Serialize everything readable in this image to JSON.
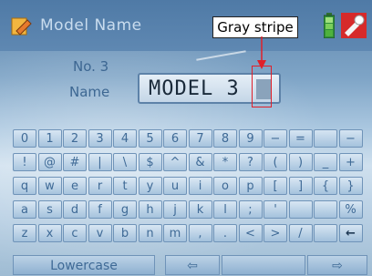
{
  "header": {
    "title": "Model Name"
  },
  "annotation": {
    "label": "Gray stripe"
  },
  "form": {
    "no_label": "No. 3",
    "name_label": "Name",
    "name_value": "MODEL 3"
  },
  "keyboard": {
    "rows": [
      [
        "0",
        "1",
        "2",
        "3",
        "4",
        "5",
        "6",
        "7",
        "8",
        "9",
        "−",
        "=",
        "",
        "−"
      ],
      [
        "!",
        "@",
        "#",
        "|",
        "\\",
        "$",
        "^",
        "&",
        "*",
        "?",
        "(",
        ")",
        "_",
        "+"
      ],
      [
        "q",
        "w",
        "e",
        "r",
        "t",
        "y",
        "u",
        "i",
        "o",
        "p",
        "[",
        "]",
        "{",
        "}"
      ],
      [
        "a",
        "s",
        "d",
        "f",
        "g",
        "h",
        "j",
        "k",
        "l",
        ";",
        "'",
        "",
        "",
        "%"
      ],
      [
        "z",
        "x",
        "c",
        "v",
        "b",
        "n",
        "m",
        ",",
        ".",
        "<",
        ">",
        "/",
        "",
        "←"
      ]
    ],
    "bottom": {
      "lowercase": "Lowercase",
      "left_arrow": "⇦",
      "right_arrow": "⇨"
    }
  },
  "icons": {
    "app": "edit-pencil-icon",
    "battery": "battery-icon",
    "tool": "tool-icon",
    "backspace": "backspace-arrow-icon"
  }
}
